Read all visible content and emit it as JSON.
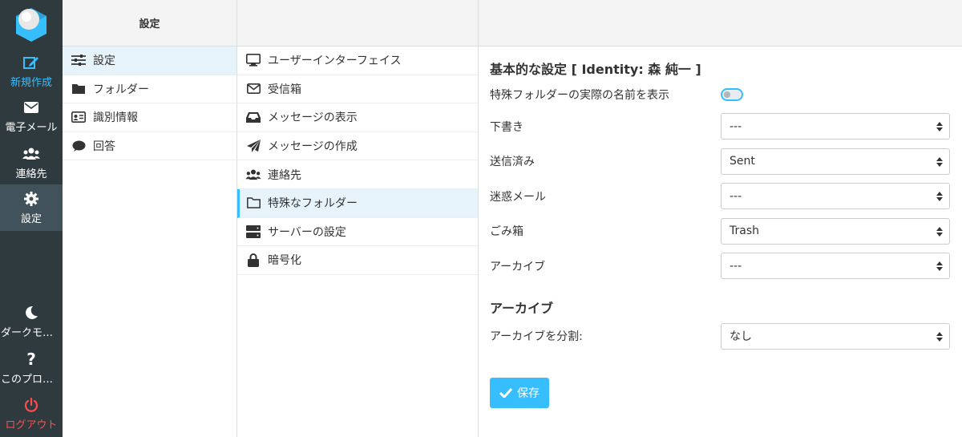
{
  "rail": {
    "compose": {
      "label": "新規作成",
      "icon": "compose-icon",
      "color": "#37beff"
    },
    "mail": {
      "label": "電子メール",
      "icon": "envelope-icon"
    },
    "contacts": {
      "label": "連絡先",
      "icon": "users-icon"
    },
    "settings": {
      "label": "設定",
      "icon": "gear-icon"
    },
    "dark": {
      "label": "ダークモード",
      "icon": "moon-icon"
    },
    "about": {
      "label": "このプログラム",
      "icon": "question-icon"
    },
    "logout": {
      "label": "ログアウト",
      "icon": "power-icon",
      "color": "#ff4d4d"
    }
  },
  "settings_panel": {
    "title": "設定",
    "items": [
      {
        "label": "設定",
        "icon": "sliders-icon",
        "selected": true
      },
      {
        "label": "フォルダー",
        "icon": "folder-icon"
      },
      {
        "label": "識別情報",
        "icon": "id-card-icon"
      },
      {
        "label": "回答",
        "icon": "comment-icon"
      }
    ]
  },
  "sections_panel": {
    "items": [
      {
        "label": "ユーザーインターフェイス",
        "icon": "monitor-icon"
      },
      {
        "label": "受信箱",
        "icon": "envelope-outline-icon"
      },
      {
        "label": "メッセージの表示",
        "icon": "inbox-icon"
      },
      {
        "label": "メッセージの作成",
        "icon": "paper-plane-icon"
      },
      {
        "label": "連絡先",
        "icon": "users-icon"
      },
      {
        "label": "特殊なフォルダー",
        "icon": "folder-outline-icon",
        "selected": true
      },
      {
        "label": "サーバーの設定",
        "icon": "server-icon"
      },
      {
        "label": "暗号化",
        "icon": "lock-icon"
      }
    ]
  },
  "form": {
    "main_title": "基本的な設定 [ Identity: 森 純一 ]",
    "show_real_names": {
      "label": "特殊フォルダーの実際の名前を表示",
      "checked": false
    },
    "drafts": {
      "label": "下書き",
      "value": "---"
    },
    "sent": {
      "label": "送信済み",
      "value": "Sent"
    },
    "junk": {
      "label": "迷惑メール",
      "value": "---"
    },
    "trash": {
      "label": "ごみ箱",
      "value": "Trash"
    },
    "archive": {
      "label": "アーカイブ",
      "value": "---"
    },
    "archive_title": "アーカイブ",
    "archive_split": {
      "label": "アーカイブを分割:",
      "value": "なし"
    },
    "save_label": "保存"
  }
}
